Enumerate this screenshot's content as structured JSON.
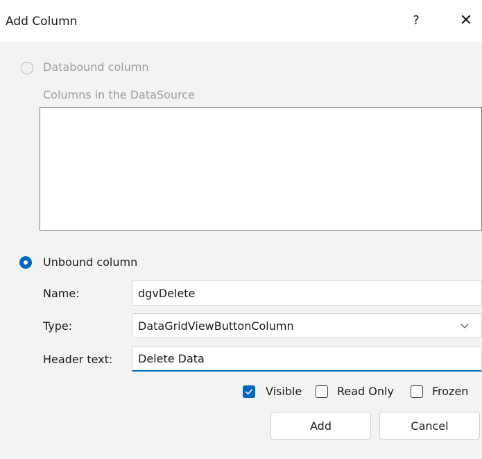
{
  "window": {
    "title": "Add Column",
    "help_glyph": "?",
    "close_glyph": "✕"
  },
  "databound": {
    "label": "Databound column",
    "columns_label": "Columns in the DataSource",
    "selected": false,
    "enabled": false
  },
  "unbound": {
    "label": "Unbound column",
    "selected": true
  },
  "form": {
    "name_label": "Name:",
    "name_value": "dgvDelete",
    "type_label": "Type:",
    "type_value": "DataGridViewButtonColumn",
    "header_label": "Header text:",
    "header_value": "Delete Data"
  },
  "options": {
    "visible_label": "Visible",
    "visible_checked": true,
    "readonly_label": "Read Only",
    "readonly_checked": false,
    "frozen_label": "Frozen",
    "frozen_checked": false
  },
  "buttons": {
    "add_label": "Add",
    "cancel_label": "Cancel"
  },
  "colors": {
    "accent": "#0067c0",
    "background": "#f3f3f3",
    "disabled_text": "#9d9d9d"
  },
  "icons": {
    "help": "help-icon",
    "close": "close-icon",
    "dropdown": "chevron-down-icon",
    "check": "checkmark-icon"
  }
}
